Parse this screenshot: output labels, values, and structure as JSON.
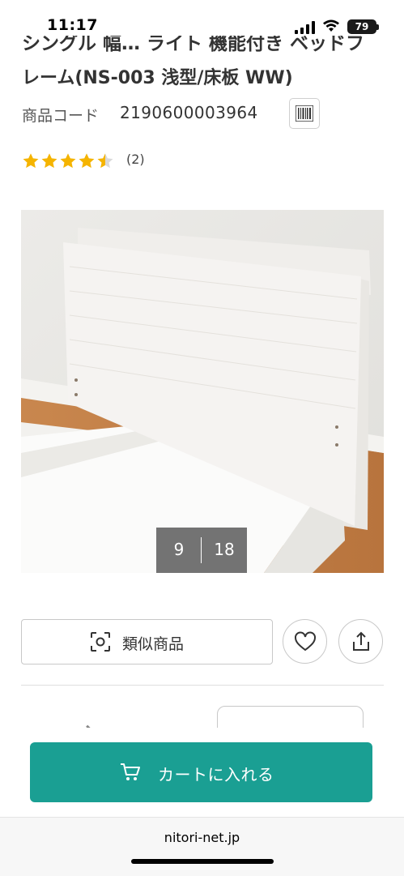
{
  "status_bar": {
    "time": "11:17",
    "battery": "79"
  },
  "product": {
    "title_line1_partial": "シングル 幅… ライト 機能付き ベッドフ",
    "title_line2": "レーム(NS-003 浅型/床板 WW)",
    "code_label": "商品コード",
    "code_value": "2190600003964",
    "rating": 4.5,
    "review_count": "(2)"
  },
  "gallery": {
    "current": "9",
    "total": "18"
  },
  "actions": {
    "similar_label": "類似商品"
  },
  "cart": {
    "label": "カートに入れる"
  },
  "browser": {
    "url": "nitori-net.jp"
  },
  "colors": {
    "accent": "#1a9f93",
    "star": "#f5b400"
  }
}
